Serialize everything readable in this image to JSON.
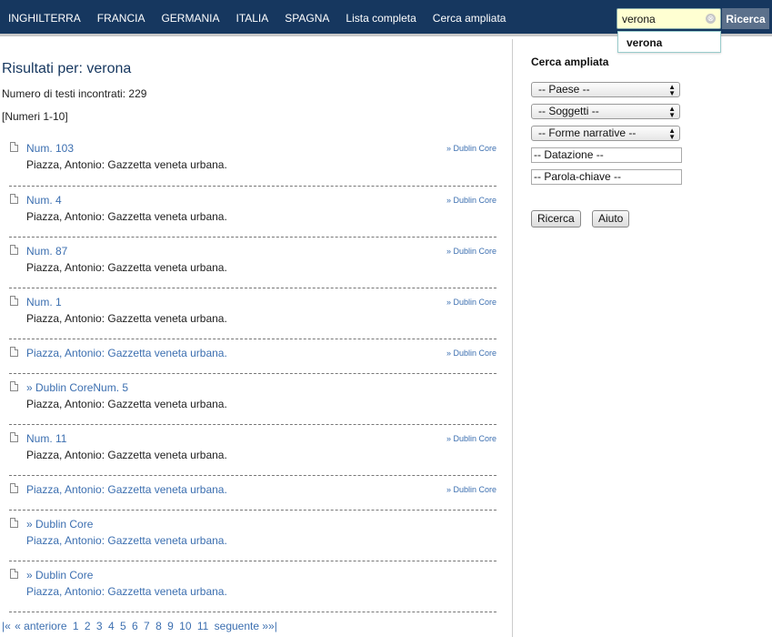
{
  "nav": {
    "items": [
      "INGHILTERRA",
      "FRANCIA",
      "GERMANIA",
      "ITALIA",
      "SPAGNA",
      "Lista completa",
      "Cerca ampliata"
    ]
  },
  "search": {
    "value": "verona",
    "button_label": "Ricerca",
    "suggestion": "verona",
    "clear_icon": "⊗"
  },
  "main": {
    "title": "Risultati per: verona",
    "count": "Numero di testi incontrati: 229",
    "range": "[Numeri 1-10]",
    "results": [
      {
        "title": "Num. 103",
        "author": "Piazza, Antonio: Gazzetta veneta urbana.",
        "dc": "» Dublin Core"
      },
      {
        "title": "Num. 4",
        "author": "Piazza, Antonio: Gazzetta veneta urbana.",
        "dc": "» Dublin Core"
      },
      {
        "title": "Num. 87",
        "author": "Piazza, Antonio: Gazzetta veneta urbana.",
        "dc": "» Dublin Core"
      },
      {
        "title": "Num. 1",
        "author": "Piazza, Antonio: Gazzetta veneta urbana.",
        "dc": "» Dublin Core"
      },
      {
        "title": "Piazza, Antonio: Gazzetta veneta urbana.",
        "author": "",
        "dc": "» Dublin Core"
      },
      {
        "title": "» Dublin CoreNum. 5",
        "author": "Piazza, Antonio: Gazzetta veneta urbana.",
        "dc": ""
      },
      {
        "title": "Num. 11",
        "author": "Piazza, Antonio: Gazzetta veneta urbana.",
        "dc": "» Dublin Core"
      },
      {
        "title": "Piazza, Antonio: Gazzetta veneta urbana.",
        "author": "",
        "dc": "» Dublin Core"
      },
      {
        "title": "» Dublin Core",
        "author": "Piazza, Antonio: Gazzetta veneta urbana.",
        "dc": ""
      },
      {
        "title": "» Dublin Core",
        "author": "Piazza, Antonio: Gazzetta veneta urbana.",
        "dc": ""
      }
    ],
    "pagination": [
      "|«",
      "« anteriore",
      "1",
      "2",
      "3",
      "4",
      "5",
      "6",
      "7",
      "8",
      "9",
      "10",
      "11",
      "seguente »",
      "»|"
    ]
  },
  "sidebar": {
    "title": "Cerca ampliata",
    "select_paese": "-- Paese --",
    "select_soggetti": "-- Soggetti --",
    "select_forme": "-- Forme narrative --",
    "field_datazione": "-- Datazione --",
    "field_parola": "-- Parola-chiave --",
    "btn_ricerca": "Ricerca",
    "btn_aiuto": "Aiuto",
    "arrow_icon": "▲▼"
  }
}
